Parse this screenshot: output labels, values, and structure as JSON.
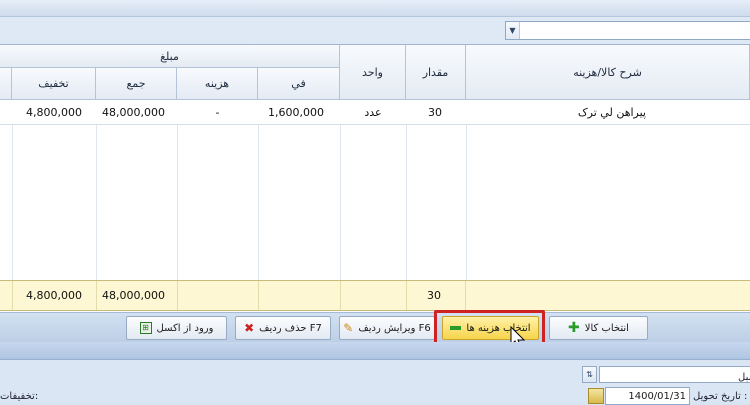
{
  "filter": {
    "dropdown_arrow": "▼"
  },
  "table": {
    "group_header": "مبلغ",
    "columns": {
      "description": "شرح كالا/هزينه",
      "quantity": "مقدار",
      "unit": "واحد",
      "unit_price": "في",
      "cost": "هزينه",
      "total": "جمع",
      "discount": "تخفيف"
    },
    "rows": [
      {
        "description": "پيراهن لي ترک",
        "quantity": "30",
        "unit": "عدد",
        "unit_price": "1,600,000",
        "cost": "-",
        "total": "48,000,000",
        "discount": "4,800,000"
      }
    ],
    "footer": {
      "quantity": "30",
      "total": "48,000,000",
      "discount": "4,800,000"
    }
  },
  "buttons": {
    "select_goods": "انتخاب كالا",
    "select_costs": "انتخاب هزينه ها",
    "edit_row": "ويرايش رديف F6",
    "delete_row": "حذف رديف F7",
    "import_excel": "ورود از اكسل"
  },
  "bottom": {
    "delivery_date_label": "تاريخ تحويل :",
    "delivery_date": "1400/01/31",
    "amount_label": "مبل",
    "discounts_label": "تخفيفات:"
  },
  "colors": {
    "highlight": "#cf2222",
    "active_button": "#f7d44c",
    "footer_row": "#fdf7d3"
  }
}
